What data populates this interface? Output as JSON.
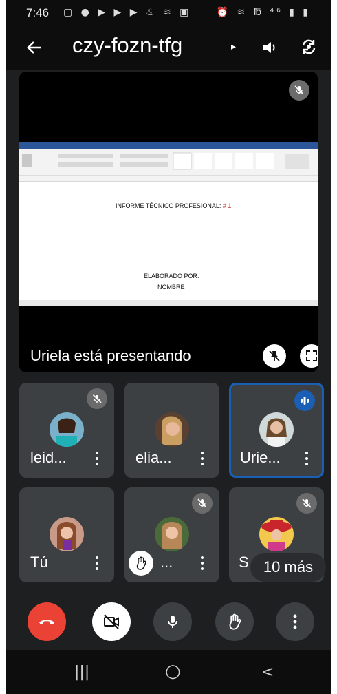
{
  "status_bar": {
    "time": "7:46",
    "left_icons": "▢ ● ▶ ▶ ▶ ♨ ≋ ▣",
    "right_icons": "⏰ ≋ ℔ ⁴⁶ ▮ ▮"
  },
  "header": {
    "meeting_code": "czy-fozn-tfg",
    "caret": "▸"
  },
  "presentation": {
    "doc_line1": "INFORME TÉCNICO PROFESIONAL:",
    "doc_line1_red": "# 1",
    "doc_line2": "ELABORADO POR:",
    "doc_line3": "NOMBRE",
    "presenting_label": "Uriela está presentando"
  },
  "participants": [
    {
      "name": "leid...",
      "muted": true,
      "speaking": false
    },
    {
      "name": "elia...",
      "muted": false,
      "speaking": false
    },
    {
      "name": "Urie...",
      "muted": false,
      "speaking": true
    },
    {
      "name": "Tú",
      "muted": false,
      "speaking": false
    },
    {
      "name": "...",
      "muted": true,
      "speaking": false,
      "hand_raised": true
    },
    {
      "name": "S",
      "muted": true,
      "speaking": false
    }
  ],
  "more_participants": "10 más",
  "colors": {
    "background": "#1e1f21",
    "tile": "#3c4043",
    "active_border": "#1a5fb4",
    "end_call": "#ea4335"
  },
  "icons": {
    "back": "arrow-left-icon",
    "speaker": "speaker-icon",
    "camera_flip": "camera-flip-icon",
    "mic_off": "mic-off-icon",
    "pin_off": "unpin-icon",
    "fullscreen": "fullscreen-icon",
    "hand": "raise-hand-icon",
    "end_call": "end-call-icon",
    "camera_off": "camera-off-icon",
    "mic": "mic-icon",
    "more": "more-vert-icon"
  },
  "navigation": {
    "recents": "|||",
    "home": "○",
    "back": "<"
  }
}
